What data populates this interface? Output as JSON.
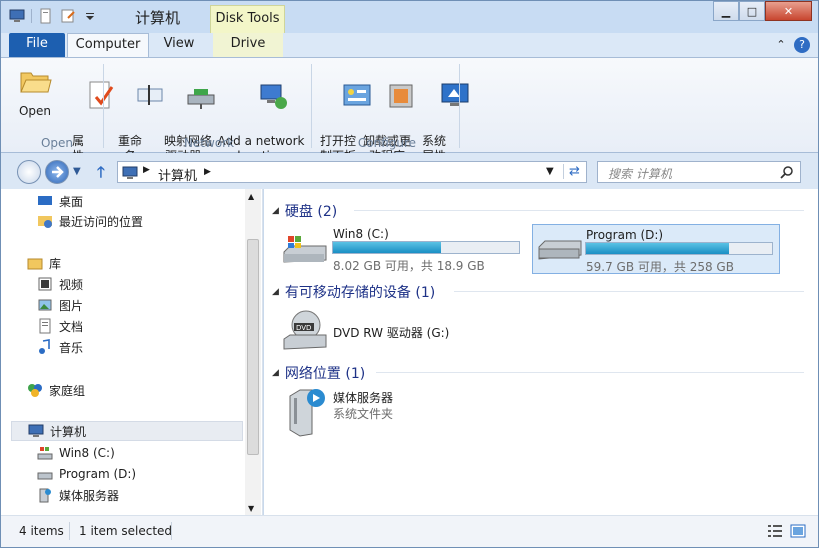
{
  "window": {
    "title": "计算机",
    "context_tab": "Disk Tools"
  },
  "ribbon_tabs": {
    "file": "File",
    "computer": "Computer",
    "view": "View",
    "drive": "Drive"
  },
  "ribbon": {
    "open_label": "Open",
    "properties_label": "属\n性",
    "rename_label": "重命\n名",
    "map_drive_label": "映射网络\n驱动器 ▾",
    "add_network_label": "Add a network\nlocation",
    "control_panel_label": "打开控\n制面板",
    "uninstall_label": "卸载或更\n改程序",
    "system_props_label": "系统\n属性",
    "group_open": "Open",
    "group_network": "Network",
    "group_configure": "Configure"
  },
  "address": {
    "path": "计算机",
    "search_placeholder": "搜索 计算机"
  },
  "nav_pane": {
    "items": [
      {
        "label": "桌面"
      },
      {
        "label": "最近访问的位置"
      },
      {
        "label": "库"
      },
      {
        "label": "视频"
      },
      {
        "label": "图片"
      },
      {
        "label": "文档"
      },
      {
        "label": "音乐"
      },
      {
        "label": "家庭组"
      },
      {
        "label": "计算机"
      },
      {
        "label": "Win8 (C:)"
      },
      {
        "label": "Program (D:)"
      },
      {
        "label": "媒体服务器"
      }
    ]
  },
  "content": {
    "hdd_header": "硬盘 (2)",
    "removable_header": "有可移动存储的设备 (1)",
    "network_header": "网络位置 (1)",
    "drives": [
      {
        "name": "Win8 (C:)",
        "free_text": "8.02 GB 可用，共 18.9 GB",
        "used_fraction": 0.58
      },
      {
        "name": "Program (D:)",
        "free_text": "59.7 GB 可用，共 258 GB",
        "used_fraction": 0.77
      }
    ],
    "dvd": {
      "name": "DVD RW 驱动器 (G:)"
    },
    "media_server": {
      "name": "媒体服务器",
      "sub": "系统文件夹"
    }
  },
  "status": {
    "items": "4 items",
    "selected": "1 item selected"
  },
  "colors": {
    "accent": "#1d5fb0",
    "bar_fill": "#1a8fc4",
    "section_header": "#1e3287"
  }
}
